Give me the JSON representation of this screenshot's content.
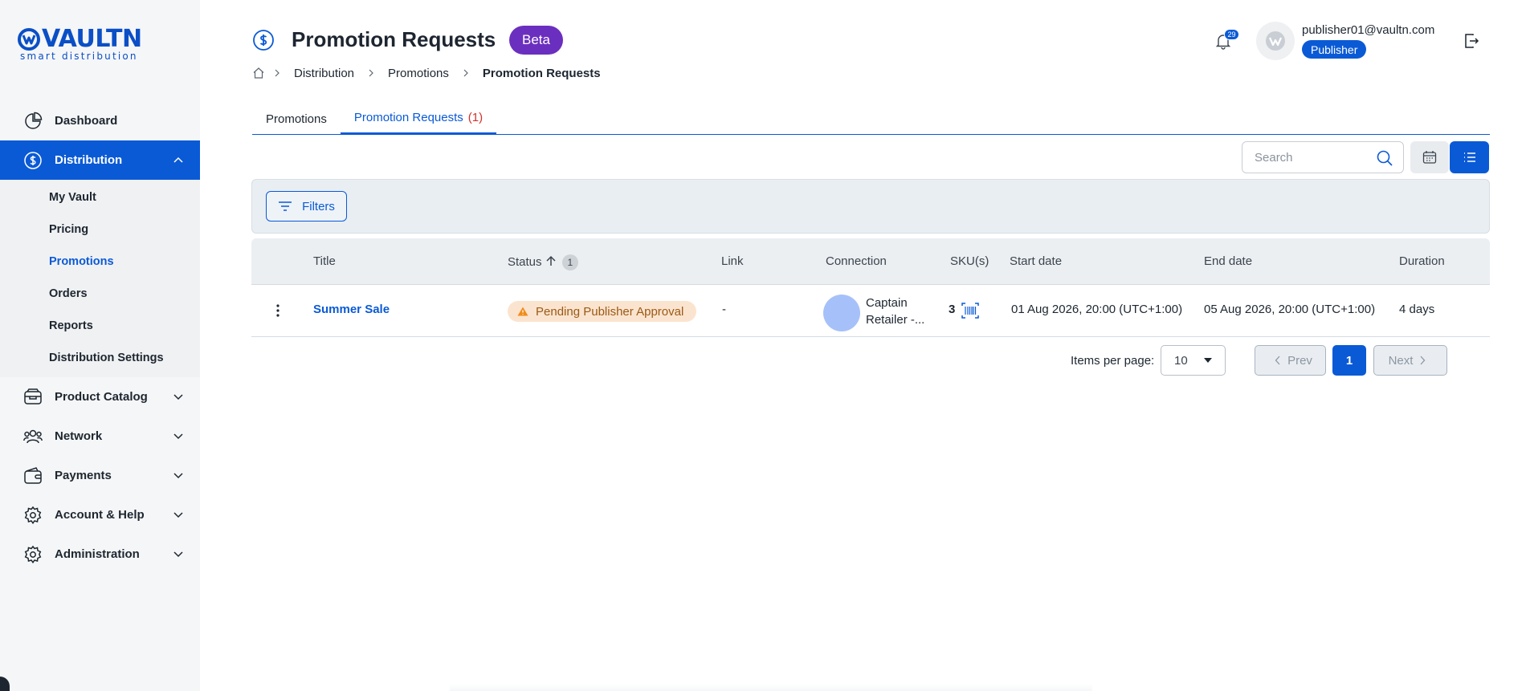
{
  "brand": {
    "name": "VAULTN",
    "tagline": "smart distribution",
    "color": "#0a4fc6"
  },
  "sidebar": {
    "items": [
      {
        "label": "Dashboard",
        "icon": "pie-chart-icon"
      },
      {
        "label": "Distribution",
        "icon": "dollar-circle-icon",
        "active": true,
        "expanded": true,
        "children": [
          "My Vault",
          "Pricing",
          "Promotions",
          "Orders",
          "Reports",
          "Distribution Settings"
        ],
        "active_child": "Promotions"
      },
      {
        "label": "Product Catalog",
        "icon": "box-icon"
      },
      {
        "label": "Network",
        "icon": "users-icon"
      },
      {
        "label": "Payments",
        "icon": "wallet-icon"
      },
      {
        "label": "Account & Help",
        "icon": "gear-icon"
      },
      {
        "label": "Administration",
        "icon": "gear-icon"
      }
    ]
  },
  "header": {
    "title": "Promotion Requests",
    "badge": "Beta",
    "icon": "dollar-circle-icon",
    "breadcrumb": [
      "Distribution",
      "Promotions",
      "Promotion Requests"
    ],
    "notifications_count": "29",
    "user_email": "publisher01@vaultn.com",
    "user_role": "Publisher"
  },
  "tabs": [
    {
      "label": "Promotions",
      "active": false
    },
    {
      "label": "Promotion Requests",
      "count": "(1)",
      "active": true
    }
  ],
  "toolbar": {
    "search_placeholder": "Search",
    "filters_label": "Filters"
  },
  "table": {
    "columns": [
      "Title",
      "Status",
      "Link",
      "Connection",
      "SKU(s)",
      "Start date",
      "End date",
      "Duration"
    ],
    "sort_count": "1",
    "rows": [
      {
        "title": "Summer Sale",
        "status": "Pending Publisher Approval",
        "link": "-",
        "connection": "Captain Retailer -...",
        "skus": "3",
        "start_date": "01 Aug 2026, 20:00 (UTC+1:00)",
        "end_date": "05 Aug 2026, 20:00 (UTC+1:00)",
        "duration": "4 days"
      }
    ]
  },
  "pagination": {
    "items_per_page_label": "Items per page:",
    "items_per_page": "10",
    "prev_label": "Prev",
    "current_page": "1",
    "next_label": "Next"
  },
  "colors": {
    "primary": "#0a5ad6",
    "beta": "#6b2fbf",
    "status_pending_bg": "#fbe4cf",
    "tab_count": "#d2312b"
  }
}
